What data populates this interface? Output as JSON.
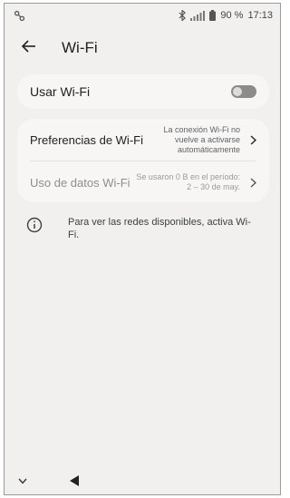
{
  "status_bar": {
    "left_icon": "link-icon",
    "icons": [
      "bluetooth-icon",
      "signal-icon",
      "battery-icon"
    ],
    "battery": "90 %",
    "time": "17:13"
  },
  "app_bar": {
    "back_icon": "arrow-back-icon",
    "title": "Wi-Fi"
  },
  "wifi_toggle": {
    "label": "Usar Wi-Fi",
    "enabled": false
  },
  "settings_list": [
    {
      "title": "Preferencias de Wi-Fi",
      "summary": "La conexión Wi-Fi no vuelve a activarse automáticamente",
      "enabled": true
    },
    {
      "title": "Uso de datos Wi-Fi",
      "summary": "Se usaron 0 B en el período: 2 – 30 de may.",
      "enabled": false
    }
  ],
  "info": {
    "icon": "info-icon",
    "text": "Para ver las redes disponibles, activa Wi-Fi."
  },
  "nav_bar": {
    "icons": [
      "chevron-down-icon",
      "back-triangle-icon"
    ]
  }
}
